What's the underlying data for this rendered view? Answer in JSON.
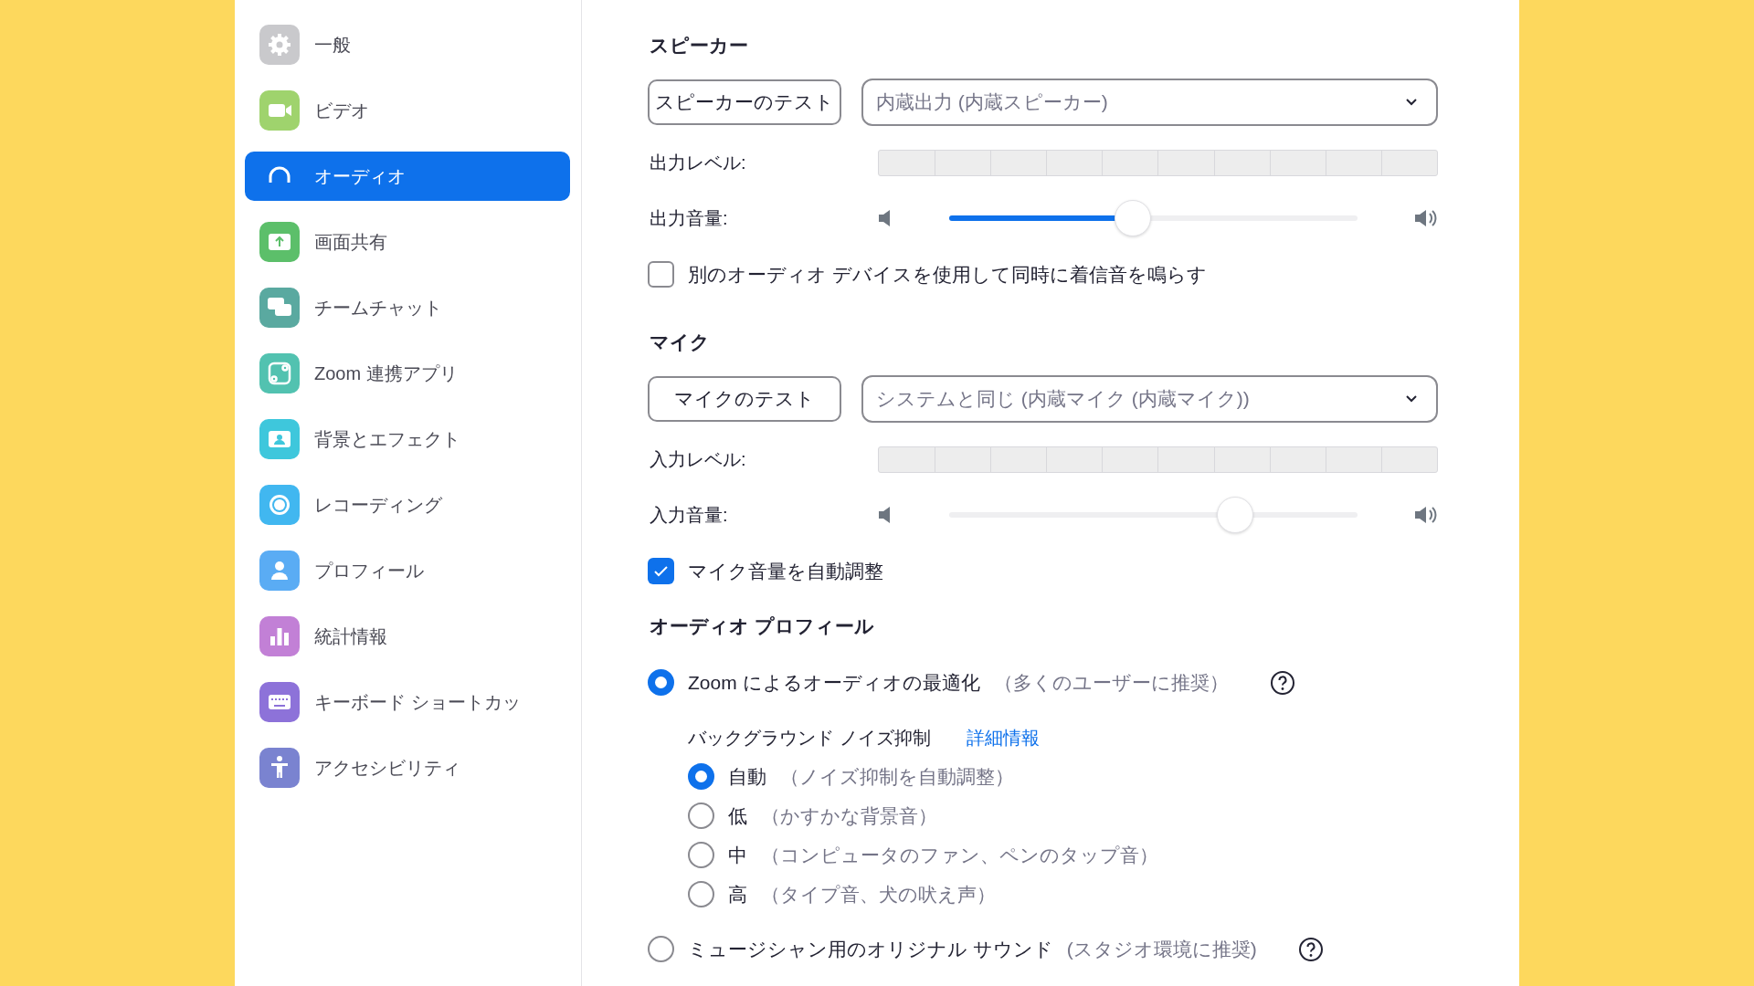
{
  "sidebar": {
    "items": [
      {
        "label": "一般",
        "selected": false
      },
      {
        "label": "ビデオ",
        "selected": false
      },
      {
        "label": "オーディオ",
        "selected": true
      },
      {
        "label": "画面共有",
        "selected": false
      },
      {
        "label": "チームチャット",
        "selected": false
      },
      {
        "label": "Zoom 連携アプリ",
        "selected": false
      },
      {
        "label": "背景とエフェクト",
        "selected": false
      },
      {
        "label": "レコーディング",
        "selected": false
      },
      {
        "label": "プロフィール",
        "selected": false
      },
      {
        "label": "統計情報",
        "selected": false
      },
      {
        "label": "キーボード ショートカッ",
        "selected": false
      },
      {
        "label": "アクセシビリティ",
        "selected": false
      }
    ]
  },
  "speaker": {
    "title": "スピーカー",
    "test_button": "スピーカーのテスト",
    "device": "内蔵出力 (内蔵スピーカー)",
    "output_level": {
      "label": "出力レベル:"
    },
    "output_volume": {
      "label": "出力音量:",
      "level": 0.45,
      "disabled": false
    },
    "ring_checkbox": {
      "label": "別のオーディオ デバイスを使用して同時に着信音を鳴らす",
      "checked": false
    }
  },
  "microphone": {
    "title": "マイク",
    "test_button": "マイクのテスト",
    "device": "システムと同じ (内蔵マイク (内蔵マイク))",
    "input_level": {
      "label": "入力レベル:"
    },
    "input_volume": {
      "label": "入力音量:",
      "level": 0.7,
      "disabled": true
    },
    "auto_adjust_checkbox": {
      "label": "マイク音量を自動調整",
      "checked": true
    }
  },
  "audio_profile": {
    "title": "オーディオ プロフィール",
    "options": [
      {
        "label": "Zoom によるオーディオの最適化",
        "note": "（多くのユーザーに推奨）",
        "selected": true,
        "noise_suppression": {
          "label": "バックグラウンド ノイズ抑制",
          "link": "詳細情報",
          "levels": [
            {
              "label": "自動",
              "note": "（ノイズ抑制を自動調整）",
              "selected": true
            },
            {
              "label": "低",
              "note": "（かすかな背景音）",
              "selected": false
            },
            {
              "label": "中",
              "note": "（コンピュータのファン、ペンのタップ音）",
              "selected": false
            },
            {
              "label": "高",
              "note": "（タイプ音、犬の吠え声）",
              "selected": false
            }
          ]
        }
      },
      {
        "label": "ミュージシャン用のオリジナル サウンド",
        "note": "(スタジオ環境に推奨)",
        "selected": false
      }
    ]
  }
}
